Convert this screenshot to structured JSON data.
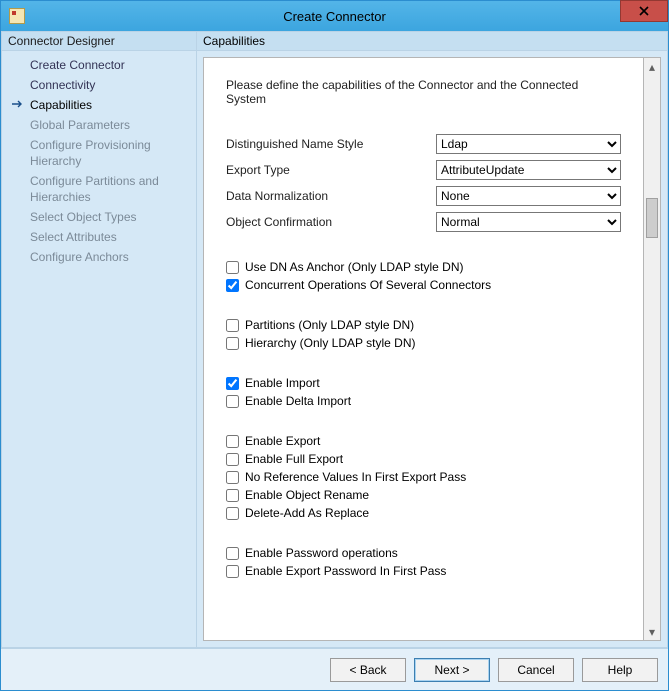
{
  "window": {
    "title": "Create Connector",
    "close_label": "Close"
  },
  "sidebar": {
    "header": "Connector Designer",
    "items": [
      {
        "label": "Create Connector",
        "active": false,
        "disabled": false
      },
      {
        "label": "Connectivity",
        "active": false,
        "disabled": false
      },
      {
        "label": "Capabilities",
        "active": true,
        "disabled": false
      },
      {
        "label": "Global Parameters",
        "active": false,
        "disabled": true
      },
      {
        "label": "Configure Provisioning Hierarchy",
        "active": false,
        "disabled": true
      },
      {
        "label": "Configure Partitions and Hierarchies",
        "active": false,
        "disabled": true
      },
      {
        "label": "Select Object Types",
        "active": false,
        "disabled": true
      },
      {
        "label": "Select Attributes",
        "active": false,
        "disabled": true
      },
      {
        "label": "Configure Anchors",
        "active": false,
        "disabled": true
      }
    ]
  },
  "content": {
    "header": "Capabilities",
    "intro": "Please define the capabilities of the Connector and the Connected System",
    "dropdowns": {
      "dn_style": {
        "label": "Distinguished Name Style",
        "value": "Ldap"
      },
      "export_type": {
        "label": "Export Type",
        "value": "AttributeUpdate"
      },
      "data_norm": {
        "label": "Data Normalization",
        "value": "None"
      },
      "obj_conf": {
        "label": "Object Confirmation",
        "value": "Normal"
      }
    },
    "checkboxes": {
      "use_dn_anchor": {
        "label": "Use DN As Anchor (Only LDAP style DN)",
        "checked": false
      },
      "concurrent_ops": {
        "label": "Concurrent Operations Of Several Connectors",
        "checked": true
      },
      "partitions": {
        "label": "Partitions (Only LDAP style DN)",
        "checked": false
      },
      "hierarchy": {
        "label": "Hierarchy (Only LDAP style DN)",
        "checked": false
      },
      "enable_import": {
        "label": "Enable Import",
        "checked": true
      },
      "enable_delta_import": {
        "label": "Enable Delta Import",
        "checked": false
      },
      "enable_export": {
        "label": "Enable Export",
        "checked": false
      },
      "enable_full_export": {
        "label": "Enable Full Export",
        "checked": false
      },
      "no_ref_values": {
        "label": "No Reference Values In First Export Pass",
        "checked": false
      },
      "enable_obj_rename": {
        "label": "Enable Object Rename",
        "checked": false
      },
      "delete_add_replace": {
        "label": "Delete-Add As Replace",
        "checked": false
      },
      "enable_pwd_ops": {
        "label": "Enable Password operations",
        "checked": false
      },
      "enable_export_pwd_first": {
        "label": "Enable Export Password In First Pass",
        "checked": false
      }
    }
  },
  "footer": {
    "back": "<  Back",
    "next": "Next  >",
    "cancel": "Cancel",
    "help": "Help"
  }
}
